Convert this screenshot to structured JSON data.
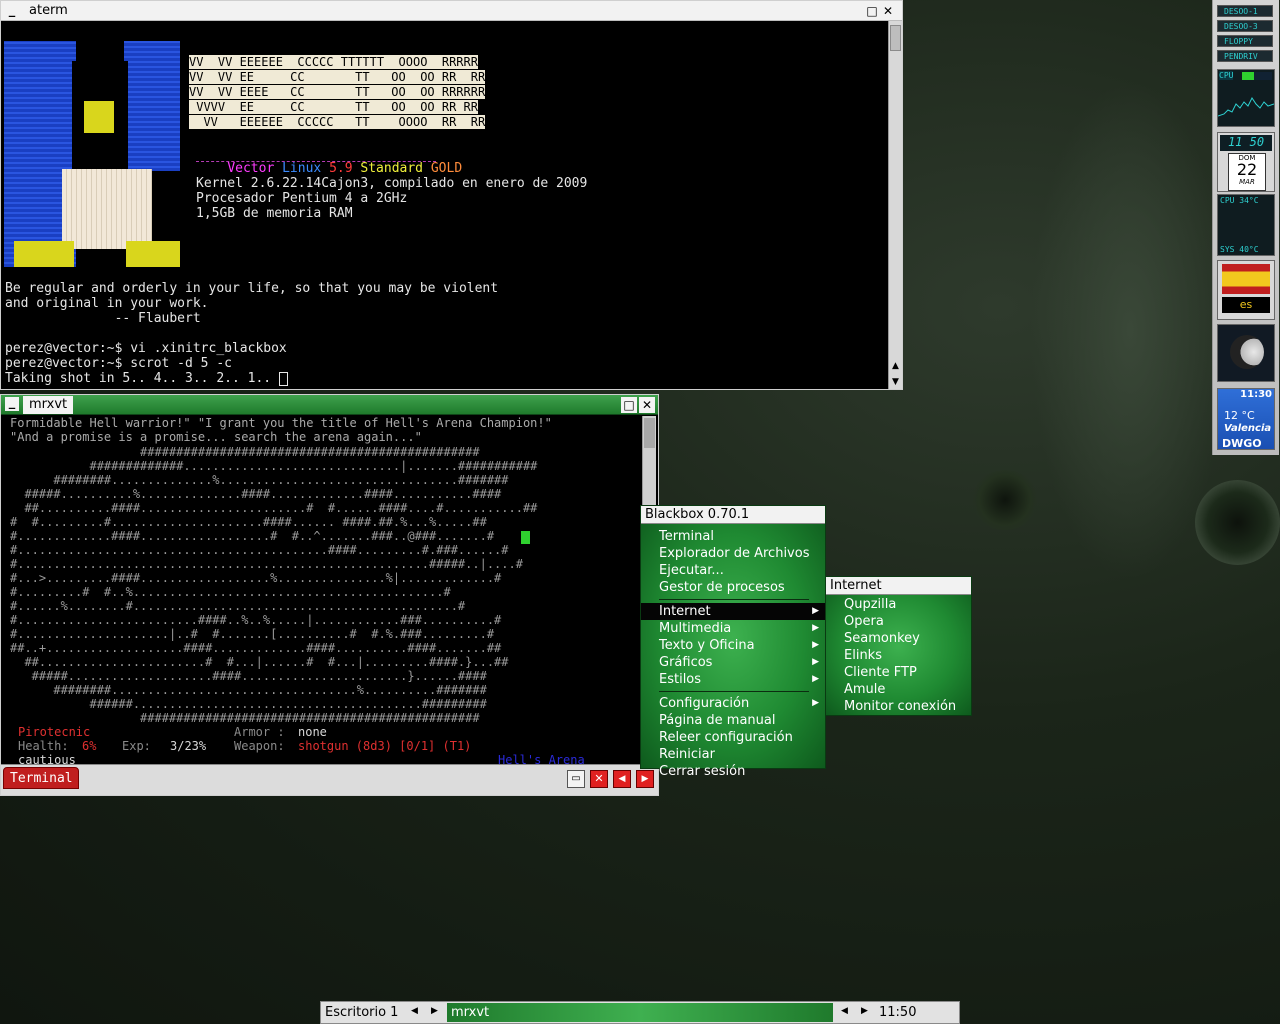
{
  "aterm": {
    "title": "aterm",
    "logo_rows": [
      "VV  VV EEEEEE  CCCCC TTTTTT  OOOO  RRRRR",
      "VV  VV EE     CC       TT   OO  OO RR  RR",
      "VV  VV EEEE   CC       TT   OO  OO RRRRRR",
      " VVVV  EE     CC       TT   OO  OO RR RR",
      "  VV   EEEEEE  CCCCC   TT    OOOO  RR  RR"
    ],
    "distro_words": [
      {
        "text": "Vector",
        "color": "#ff3bff"
      },
      {
        "text": "Linux",
        "color": "#3b8bff"
      },
      {
        "text": "5.9",
        "color": "#ff3b3b"
      },
      {
        "text": "Standard",
        "color": "#f0f03b"
      },
      {
        "text": "GOLD",
        "color": "#ff8c3b"
      }
    ],
    "info_lines": [
      "Kernel 2.6.22.14Cajon3, compilado en enero de 2009",
      "Procesador Pentium 4 a 2GHz",
      "1,5GB de memoria RAM"
    ],
    "quote_lines": [
      "Be regular and orderly in your life, so that you may be violent",
      "and original in your work.",
      "              -- Flaubert"
    ],
    "prompt_lines": [
      "perez@vector:~$ vi .xinitrc_blackbox",
      "perez@vector:~$ scrot -d 5 -c",
      "Taking shot in 5.. 4.. 3.. 2.. 1.. "
    ]
  },
  "mrxvt": {
    "title": "mrxvt",
    "message_lines": [
      "Formidable Hell warrior!\" \"I grant you the title of Hell's Arena Champion!\"",
      "\"And a promise is a promise... search the arena again...\""
    ],
    "map_lines": [
      "                  ###############################################",
      "           #############..............................|.......###########",
      "      ########..............%.................................#######",
      "  #####..........%..............####.............####...........####",
      "  ##..........####.......................#  #......####....#...........##",
      "#  #.........#.....................####...... ####.##.%...%.....##",
      "#.............####..................#  #..^.......###..@###.......#",
      "#...........................................####.........#.###......#",
      "#.........................................................#####..|....#",
      "#...>.........####..................%...............%|.............#",
      "#.........#  #..%...........................................#",
      "#......%........#.............................................#",
      "#.........................####..%..%.....|............###..........#",
      "#.....................|..#  #.......[..........#  #.%.###.........#",
      "##..+...................####.............####..........####.......##",
      "  ##.......................#  #...|......#  #...|.........####.}...##",
      "   #####....................####.......................}......####",
      "      ########..................................%..........#######",
      "           ######........................................#########",
      "                  ###############################################"
    ],
    "char_name": "Pirotecnic",
    "armor_label": "Armor :",
    "armor_value": "none",
    "health_label": "Health:",
    "health_value": "6%",
    "exp_label": "Exp:",
    "exp_value": "3/23%",
    "weapon_label": "Weapon:",
    "weapon_value": "shotgun (8d3) [0/1] (T1)",
    "location": "Hell's Arena",
    "tactic": "cautious",
    "tab_label": "Terminal"
  },
  "menu": {
    "title": "Blackbox 0.70.1",
    "items_top": [
      "Terminal",
      "Explorador de Archivos",
      "Ejecutar...",
      "Gestor de procesos"
    ],
    "items_sub": [
      "Internet",
      "Multimedia",
      "Texto y Oficina",
      "Gráficos",
      "Estilos"
    ],
    "items_bottom": [
      "Configuración",
      "Página de manual",
      "Releer configuración",
      "Reiniciar",
      "Cerrar sesión"
    ]
  },
  "submenu": {
    "title": "Internet",
    "items": [
      "Qupzilla",
      "Opera",
      "Seamonkey",
      "Elinks",
      "Cliente FTP",
      "Amule",
      "Monitor conexión"
    ]
  },
  "dock": {
    "drives": [
      "DESOO-1",
      "DESOO-3",
      "FLOPPY",
      "PENDRIV"
    ],
    "cpu_label": "CPU",
    "clock": "11 50",
    "day_name": "DOM",
    "day_num": "22",
    "month": "MAR",
    "cpu_temp": "CPU  34°C",
    "sys_temp": "SYS  40°C",
    "lang": "es",
    "weather_time": "11:30",
    "weather_temp": "12 °C",
    "weather_city": "Valencia",
    "weather_brand": "DWGO"
  },
  "taskbar": {
    "workspace": "Escritorio 1",
    "window": "mrxvt",
    "clock": "11:50"
  }
}
